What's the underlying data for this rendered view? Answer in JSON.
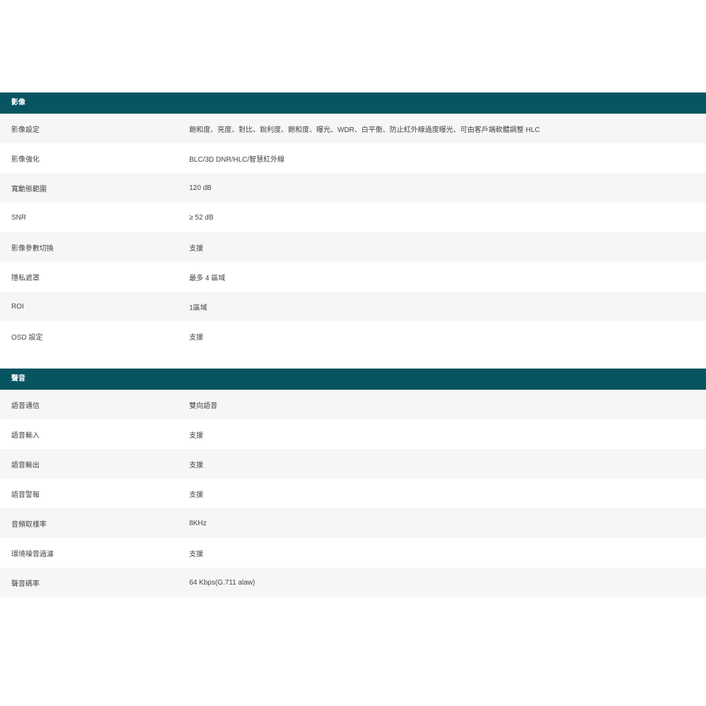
{
  "video": {
    "title": "影像",
    "rows": [
      {
        "label": "影像設定",
        "value": "飽和度、亮度、對比、銳利度、飽和度、曝光、WDR、白平衡、防止紅外線過度曝光、可由客戶端軟體調整 HLC"
      },
      {
        "label": "影像強化",
        "value": "BLC/3D DNR/HLC/智慧紅外線"
      },
      {
        "label": "寬動態範圍",
        "value": "120 dB"
      },
      {
        "label": "SNR",
        "value": "≥ 52 dB"
      },
      {
        "label": "影像參數切換",
        "value": "支援"
      },
      {
        "label": "隱私遮罩",
        "value": "最多 4 區域"
      },
      {
        "label": "ROI",
        "value": "1區域"
      },
      {
        "label": "OSD 設定",
        "value": "支援"
      }
    ]
  },
  "audio": {
    "title": "聲音",
    "rows": [
      {
        "label": "語音通信",
        "value": "雙向語音"
      },
      {
        "label": "語音輸入",
        "value": "支援"
      },
      {
        "label": "語音輸出",
        "value": "支援"
      },
      {
        "label": "語音警報",
        "value": "支援"
      },
      {
        "label": "音頻取樣率",
        "value": "8KHz"
      },
      {
        "label": "環境噪音過濾",
        "value": "支援"
      },
      {
        "label": "聲音碼率",
        "value": "64 Kbps(G.711 alaw)"
      }
    ]
  }
}
